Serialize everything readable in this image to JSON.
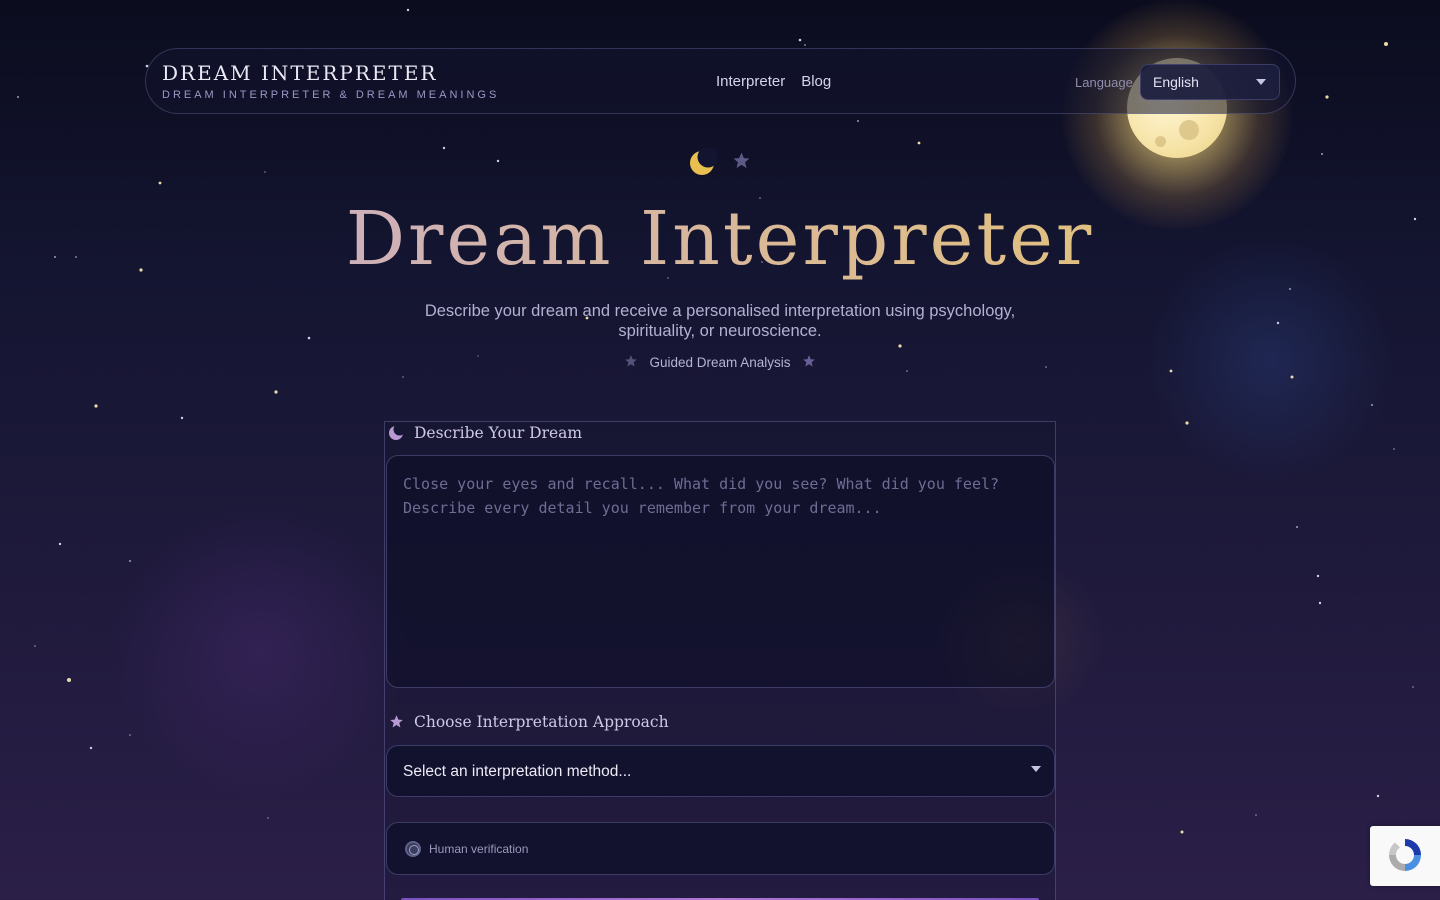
{
  "brand": {
    "title": "DREAM INTERPRETER",
    "subtitle": "DREAM INTERPRETER & DREAM MEANINGS"
  },
  "nav": {
    "links": [
      "Interpreter",
      "Blog"
    ],
    "language_label": "Language",
    "language_value": "English"
  },
  "hero": {
    "title": "Dream Interpreter",
    "subtitle": "Describe your dream and receive a personalised interpretation using psychology, spirituality, or neuroscience.",
    "tagline": "Guided Dream Analysis"
  },
  "form": {
    "dream_label": "Describe Your Dream",
    "dream_placeholder": "Close your eyes and recall... What did you see? What did you feel? Describe every detail you remember from your dream...",
    "approach_label": "Choose Interpretation Approach",
    "approach_placeholder": "Select an interpretation method...",
    "verification_label": "Human verification"
  },
  "icons": {
    "hero_moon": "crescent-moon-icon",
    "hero_star": "star-icon",
    "dream_label_icon": "crescent-moon-icon",
    "approach_label_icon": "star-icon",
    "dropdown": "chevron-down-icon",
    "recaptcha": "recaptcha-icon"
  },
  "colors": {
    "background_top": "#0b0c1e",
    "background_bottom": "#2b1f48",
    "gold_accent": "#e8c76a",
    "lavender_accent": "#c3a9d6",
    "text_muted": "#b3b0d2"
  }
}
